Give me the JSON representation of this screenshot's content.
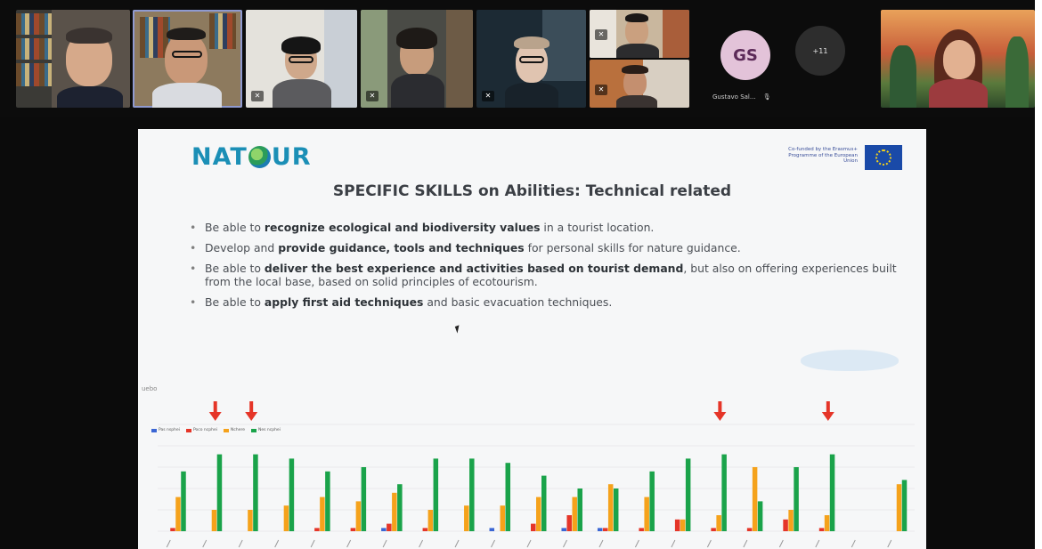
{
  "participants": {
    "avatar": {
      "initials": "GS",
      "name": "Gustavo Sal...",
      "mic_icon": "mic-muted-icon"
    },
    "overflow": {
      "label": "+11"
    }
  },
  "slide": {
    "logo_text": [
      "NAT",
      "UR"
    ],
    "eu_caption": "Co-funded by the Erasmus+ Programme of the European Union",
    "title": "SPECIFIC SKILLS on Abilities: Technical related",
    "bullets": [
      {
        "pre": "Be able to ",
        "bold": "recognize ecological and biodiversity values",
        "post": " in a tourist location."
      },
      {
        "pre": "Develop and ",
        "bold": "provide guidance, tools and techniques",
        "post": " for personal skills for nature guidance."
      },
      {
        "pre": "Be able to ",
        "bold": "deliver the best experience and activities based on tourist demand",
        "post": ", but also on offering experiences built from the local base, based on solid principles of ecotourism."
      },
      {
        "pre": "Be able to ",
        "bold": "apply first aid techniques",
        "post": " and basic evacuation techniques."
      }
    ]
  },
  "chart_data": {
    "type": "bar",
    "title": "",
    "ylabel_text": "uebo",
    "ylim": [
      0,
      5
    ],
    "grid": true,
    "legend_position": "top-left",
    "series_colors": [
      "#3b66d4",
      "#e53528",
      "#f5a21b",
      "#1aa34a"
    ],
    "series": [
      {
        "name": "Pas nsphei",
        "values": [
          0,
          0,
          0,
          0,
          0,
          0,
          0.15,
          0,
          0,
          0.15,
          0,
          0.15,
          0.15,
          0,
          0,
          0,
          0,
          0,
          0,
          0,
          0
        ]
      },
      {
        "name": "Poco ncphei",
        "values": [
          0.15,
          0,
          0,
          0,
          0.15,
          0.15,
          0.35,
          0.15,
          0,
          0,
          0.35,
          0.75,
          0.15,
          0.15,
          0.55,
          0.15,
          0.15,
          0.55,
          0.15,
          0,
          0
        ]
      },
      {
        "name": "Nchere",
        "values": [
          1.6,
          1,
          1,
          1.2,
          1.6,
          1.4,
          1.8,
          1,
          1.2,
          1.2,
          1.6,
          1.6,
          2.2,
          1.6,
          0.55,
          0.75,
          3,
          1,
          0.75,
          0,
          2.2
        ]
      },
      {
        "name": "Nes ncphei",
        "values": [
          2.8,
          3.6,
          3.6,
          3.4,
          2.8,
          3,
          2.2,
          3.4,
          3.4,
          3.2,
          2.6,
          2,
          2,
          2.8,
          3.4,
          3.6,
          1.4,
          3,
          3.6,
          0,
          2.4
        ]
      }
    ],
    "categories": [
      "",
      "",
      "",
      "",
      "",
      "",
      "",
      "",
      "",
      "",
      "",
      "",
      "",
      "",
      "",
      "",
      "",
      "",
      "",
      "",
      ""
    ],
    "highlight_markers": [
      1,
      2,
      15,
      18
    ],
    "marker_color": "#e53528"
  }
}
